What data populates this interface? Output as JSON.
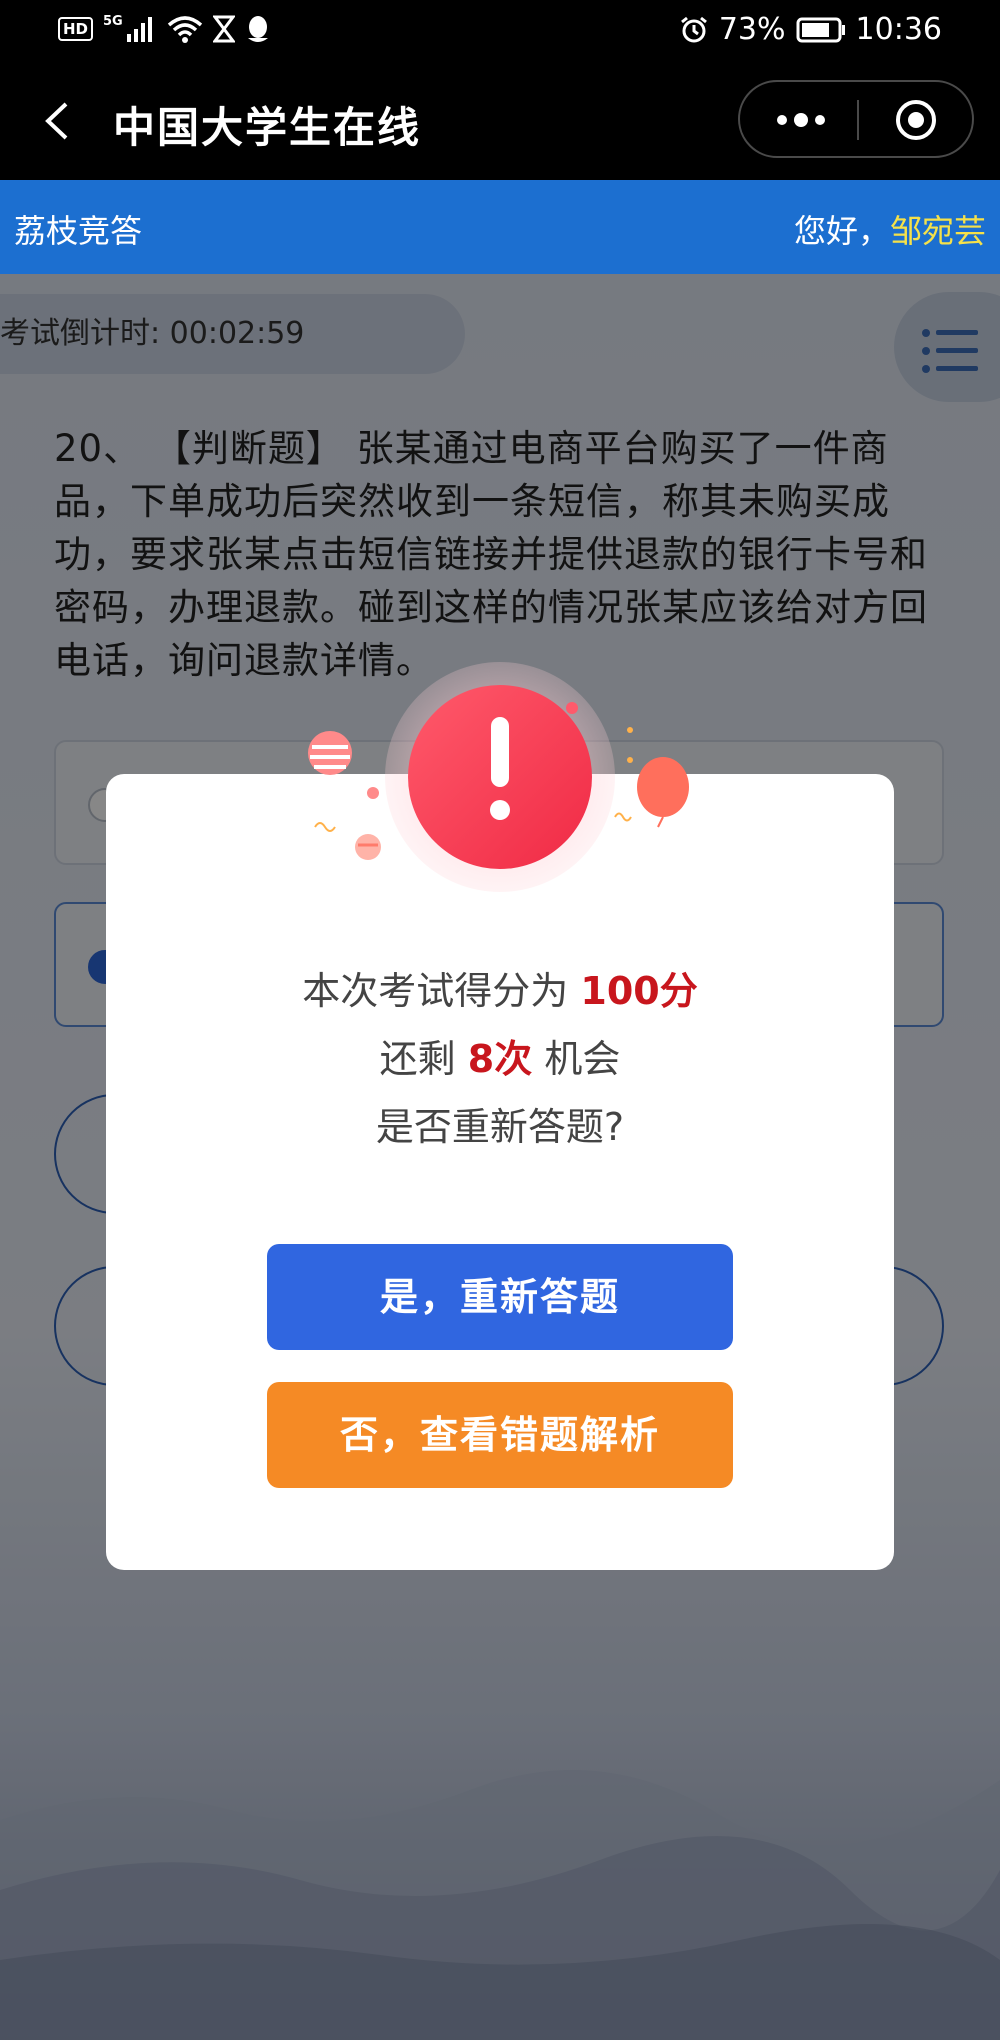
{
  "status_bar": {
    "hd_label": "HD",
    "network_label": "5G",
    "battery_percent": "73%",
    "time": "10:36"
  },
  "nav": {
    "title": "中国大学生在线"
  },
  "header": {
    "app_name": "荔枝竞答",
    "greeting": "您好，",
    "user_name": "邹宛芸"
  },
  "exam": {
    "timer_label": "考试倒计时:",
    "timer_value": "00:02:59",
    "question_text": "20、 【判断题】 张某通过电商平台购买了一件商品，下单成功后突然收到一条短信，称其未购买成功，要求张某点击短信链接并提供退款的银行卡号和密码，办理退款。碰到这样的情况张某应该给对方回电话，询问退款详情。",
    "selected_option_index": 2
  },
  "dialog": {
    "score_prefix": "本次考试得分为",
    "score_value": "100分",
    "remain_prefix": "还剩",
    "remain_value": "8次",
    "remain_suffix": "机会",
    "question": "是否重新答题?",
    "retry_label": "是，重新答题",
    "review_label": "否，查看错题解析"
  },
  "colors": {
    "header_blue": "#1c6fd0",
    "username_yellow": "#f5e14a",
    "highlight_red": "#c8161d",
    "retry_blue": "#3066e0",
    "review_orange": "#f58a25",
    "alert_red": "#f53d52"
  },
  "icons": [
    "back-icon",
    "more-icon",
    "target-icon",
    "menu-icon",
    "alarm-icon",
    "battery-icon",
    "wifi-icon",
    "signal-icon",
    "hourglass-icon",
    "qq-icon",
    "alert-icon"
  ]
}
